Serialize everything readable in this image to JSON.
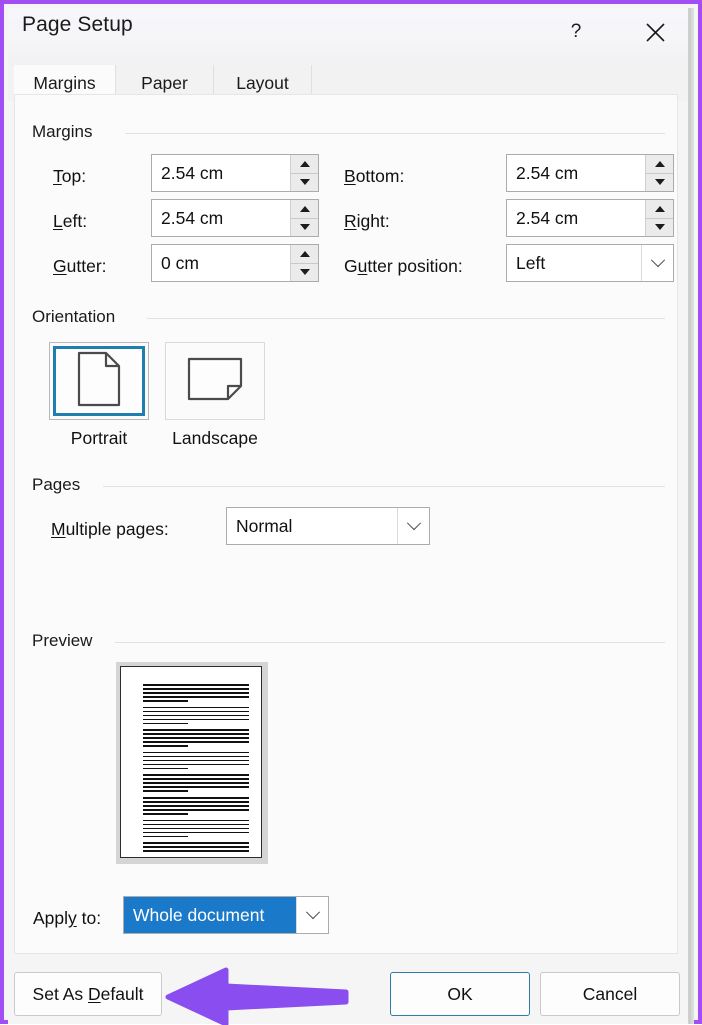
{
  "window": {
    "title": "Page Setup",
    "help_label": "?",
    "close_label": "✕",
    "accent_border_color": "#a34ef5"
  },
  "tabs": [
    {
      "label": "Margins",
      "active": true
    },
    {
      "label": "Paper",
      "active": false
    },
    {
      "label": "Layout",
      "active": false
    }
  ],
  "groups": {
    "margins": "Margins",
    "orientation": "Orientation",
    "pages": "Pages",
    "preview": "Preview"
  },
  "margins": {
    "top": {
      "label": "Top:",
      "value": "2.54 cm"
    },
    "bottom": {
      "label": "Bottom:",
      "value": "2.54 cm"
    },
    "left": {
      "label": "Left:",
      "value": "2.54 cm"
    },
    "right": {
      "label": "Right:",
      "value": "2.54 cm"
    },
    "gutter": {
      "label": "Gutter:",
      "value": "0 cm"
    },
    "gutter_position": {
      "label": "Gutter position:",
      "value": "Left"
    }
  },
  "orientation": {
    "portrait": {
      "label": "Portrait",
      "selected": true
    },
    "landscape": {
      "label": "Landscape",
      "selected": false
    },
    "selected_color": "#1f7eb0"
  },
  "pages": {
    "multiple_pages": {
      "label": "Multiple pages:",
      "value": "Normal"
    }
  },
  "apply": {
    "label": "Apply to:",
    "value": "Whole document",
    "highlight_color": "#1a79c9"
  },
  "buttons": {
    "set_as_default": "Set As Default",
    "ok": "OK",
    "cancel": "Cancel",
    "ok_border_color": "#2c7fa6"
  },
  "annotation": {
    "arrow_color": "#8a4ef0",
    "points_to": "Set As Default"
  }
}
